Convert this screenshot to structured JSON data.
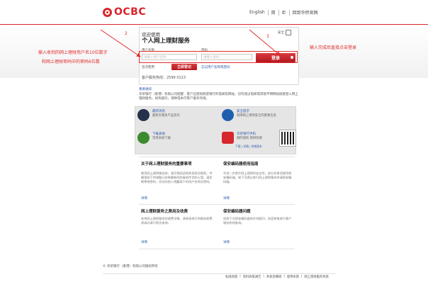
{
  "brand": {
    "name": "OCBC",
    "color": "#d7262c"
  },
  "header": {
    "lang_en": "English",
    "lang_tc": "简",
    "contact_icon": "phone-icon",
    "logout": "回到华侨官网"
  },
  "login": {
    "welcome": "欢迎使用",
    "title": "个人网上理财服务",
    "secure_label": "安全",
    "user_label": "用户名称",
    "user_placeholder": "请输入用户名称",
    "pass_label": "密码",
    "pass_placeholder": "请输入密码",
    "login_button": "登录",
    "register_label": "首次使用",
    "register_button": "立即登记",
    "forgot_link": "忘记用户名称或密码",
    "hotline": "客户服务热线：2599 0123"
  },
  "annotations": {
    "left": [
      "输入收到的网上理财用户名10位数字",
      "和网上理财密码中的密码6位数"
    ],
    "right": "输入完成后直接点击登录",
    "num1": "2",
    "num2": "3"
  },
  "notice": {
    "title": "重要通知",
    "body": "华侨银行（香港）有限公司提醒：客户应提防假冒银行的电邮及网站，切勿透过电邮或其他不明网站链接登入网上理财服务。如有疑问，请致电本行客户服务热线。"
  },
  "tiles": [
    {
      "title": "最新消息",
      "sub": "最新优惠及产品资讯",
      "icon": "speaker-icon",
      "color": "#24324b"
    },
    {
      "title": "安全提示",
      "sub": "保障网上理财安全的重要信息",
      "icon": "shield-star-icon",
      "color": "#1f5fb0"
    },
    {
      "title": "下载表格",
      "sub": "常用表格下载",
      "icon": "download-icon",
      "color": "#3c8a2e"
    },
    {
      "title": "华侨银行手机",
      "sub": "随时随地 理财快捷",
      "icon": "mobile-app-icon",
      "color": "#d7262c"
    }
  ],
  "tile_extra": {
    "link": "下载 | 详情 | 其他版本",
    "qr": "qr-code-icon"
  },
  "panels": [
    {
      "title": "关于网上理财服务的重要事项",
      "body": "使用网上理财服务前，请仔细阅读相关条款及细则，并确保阁下的电脑已安装最新的防毒软件及防火墙。请定期更改密码，切勿向他人透露阁下的用户名称及密码。",
      "link": "详情"
    },
    {
      "title": "保安编码器使用指南",
      "body": "为进一步提升网上理财的安全性，部分交易须使用保安编码器。阁下可透过本行网上理财服务申请保安编码器。",
      "link": "详情"
    },
    {
      "title": "网上理财服务之费用及收费",
      "body": "有关网上理财服务的收费详情，请参阅本行的服务收费表或向本行职员查询。",
      "link": "详情"
    },
    {
      "title": "保安编码器问题",
      "body": "如阁下对保安编码器有任何疑问，欢迎致电本行客户服务热线查询。",
      "link": "详情"
    }
  ],
  "footer": {
    "copyright": "© 华侨银行（香港）有限公司版权所有",
    "links": [
      "私隐政策",
      "资料政策通告",
      "条款及细则",
      "使用条款",
      "网上理财服务条款"
    ]
  }
}
